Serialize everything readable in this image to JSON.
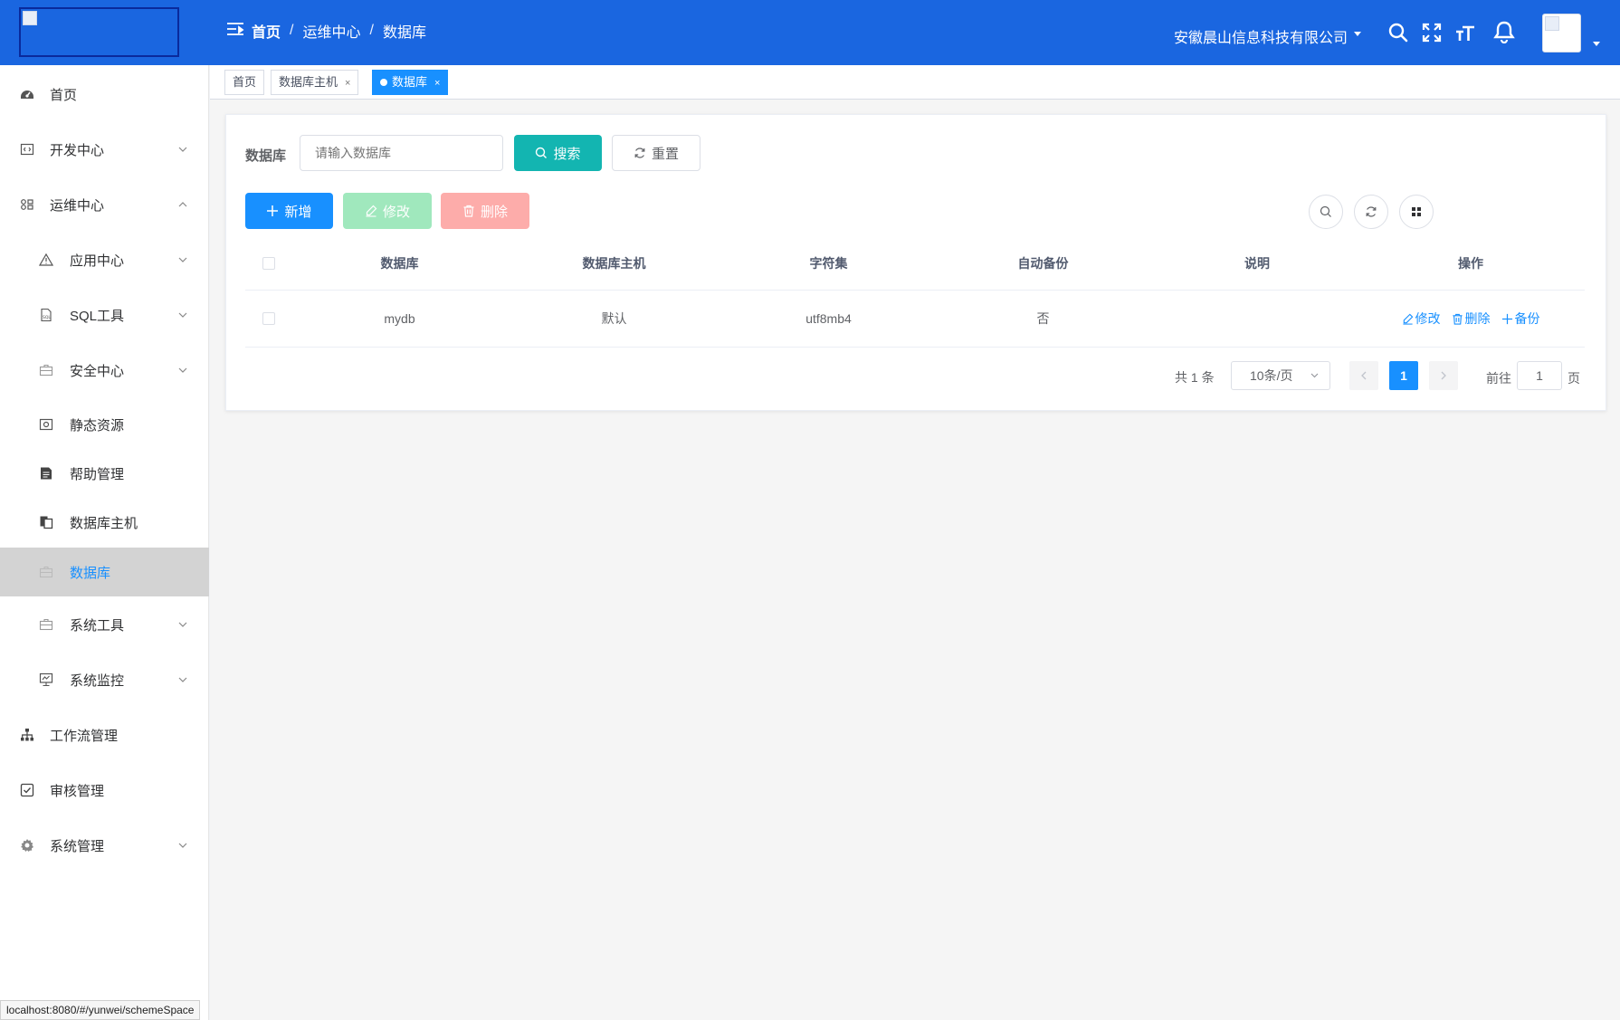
{
  "header": {
    "breadcrumb": [
      "首页",
      "运维中心",
      "数据库"
    ],
    "breadcrumb_sep": "/",
    "company": "安徽晨山信息科技有限公司",
    "icons": [
      "search-icon",
      "fullscreen-icon",
      "font-size-icon",
      "bell-icon"
    ],
    "accent": "#1a66e0"
  },
  "sidebar": {
    "items": [
      {
        "label": "首页",
        "icon": "dashboard-icon"
      },
      {
        "label": "开发中心",
        "icon": "code-icon"
      },
      {
        "label": "运维中心",
        "icon": "ops-icon"
      },
      {
        "label": "应用中心",
        "icon": "warning-icon"
      },
      {
        "label": "SQL工具",
        "icon": "sql-icon"
      },
      {
        "label": "安全中心",
        "icon": "briefcase-icon"
      },
      {
        "label": "静态资源",
        "icon": "image-icon"
      },
      {
        "label": "帮助管理",
        "icon": "document-icon"
      },
      {
        "label": "数据库主机",
        "icon": "copy-icon"
      },
      {
        "label": "数据库",
        "icon": "briefcase-icon"
      },
      {
        "label": "系统工具",
        "icon": "briefcase-icon"
      },
      {
        "label": "系统监控",
        "icon": "monitor-icon"
      },
      {
        "label": "工作流管理",
        "icon": "tree-icon"
      },
      {
        "label": "审核管理",
        "icon": "checkbox-icon"
      },
      {
        "label": "系统管理",
        "icon": "gear-icon"
      }
    ],
    "active": "数据库"
  },
  "tabs": [
    {
      "label": "首页",
      "closable": false
    },
    {
      "label": "数据库主机",
      "closable": true
    },
    {
      "label": "数据库",
      "closable": true,
      "active": true
    }
  ],
  "search": {
    "label": "数据库",
    "placeholder": "请输入数据库",
    "search_btn": "搜索",
    "reset_btn": "重置"
  },
  "toolbar": {
    "add": "新增",
    "edit": "修改",
    "delete": "删除"
  },
  "table": {
    "columns": [
      "数据库",
      "数据库主机",
      "字符集",
      "自动备份",
      "说明",
      "操作"
    ],
    "rows": [
      {
        "database": "mydb",
        "host": "默认",
        "charset": "utf8mb4",
        "auto_backup": "否",
        "note": ""
      }
    ],
    "row_actions": [
      "修改",
      "删除",
      "备份"
    ]
  },
  "pagination": {
    "total": "共 1 条",
    "page_size": "10条/页",
    "current_page": "1",
    "goto_label": "前往",
    "goto_value": "1",
    "page_suffix": "页"
  },
  "statusbar": "localhost:8080/#/yunwei/schemeSpace"
}
